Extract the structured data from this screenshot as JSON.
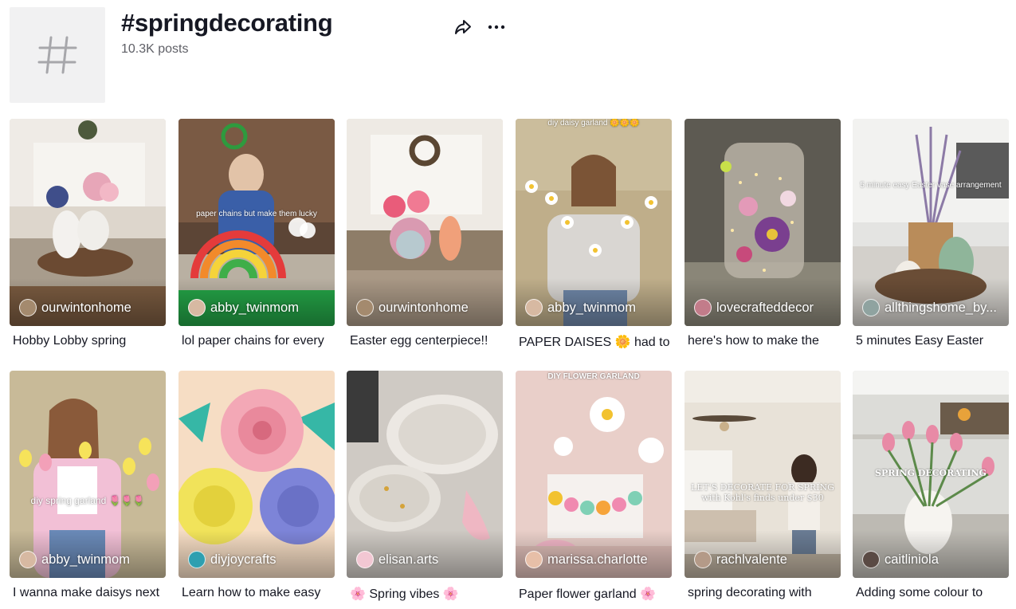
{
  "hashtag": {
    "title": "#springdecorating",
    "posts_count": "10.3K posts"
  },
  "actions": {
    "share_icon": "share-icon",
    "more_icon": "more-horizontal-icon"
  },
  "videos": [
    {
      "username": "ourwintonhome",
      "caption": "Hobby Lobby spring",
      "overlay": ""
    },
    {
      "username": "abby_twinmom",
      "caption": "lol paper chains for every",
      "overlay": "paper chains but make them lucky"
    },
    {
      "username": "ourwintonhome",
      "caption": "Easter egg centerpiece!!",
      "overlay": ""
    },
    {
      "username": "abby_twinmom",
      "caption": "PAPER DAISES 🌼 had to",
      "overlay": "diy daisy garland 🌼🌼🌼"
    },
    {
      "username": "lovecrafteddecor",
      "caption": "here's how to make the",
      "overlay": ""
    },
    {
      "username": "allthingshome_by...",
      "caption": "5 minutes Easy Easter",
      "overlay": "5 minute easy Easter vase arrangement"
    },
    {
      "username": "abby_twinmom",
      "caption": "I wanna make daisys next",
      "overlay": "diy spring garland 🌷🌷🌷"
    },
    {
      "username": "diyjoycrafts",
      "caption": "Learn how to make easy",
      "overlay": ""
    },
    {
      "username": "elisan.arts",
      "caption": "🌸 Spring vibes 🌸",
      "overlay": ""
    },
    {
      "username": "marissa.charlotte",
      "caption": "Paper flower garland 🌸",
      "overlay": "DIY FLOWER GARLAND"
    },
    {
      "username": "rachlvalente",
      "caption": "spring decorating with",
      "overlay": "LET'S DECORATE FOR SPRING with Kohl's finds under $30"
    },
    {
      "username": "caitliniola",
      "caption": "Adding some colour to",
      "overlay": "SPRING DECORATING"
    }
  ]
}
